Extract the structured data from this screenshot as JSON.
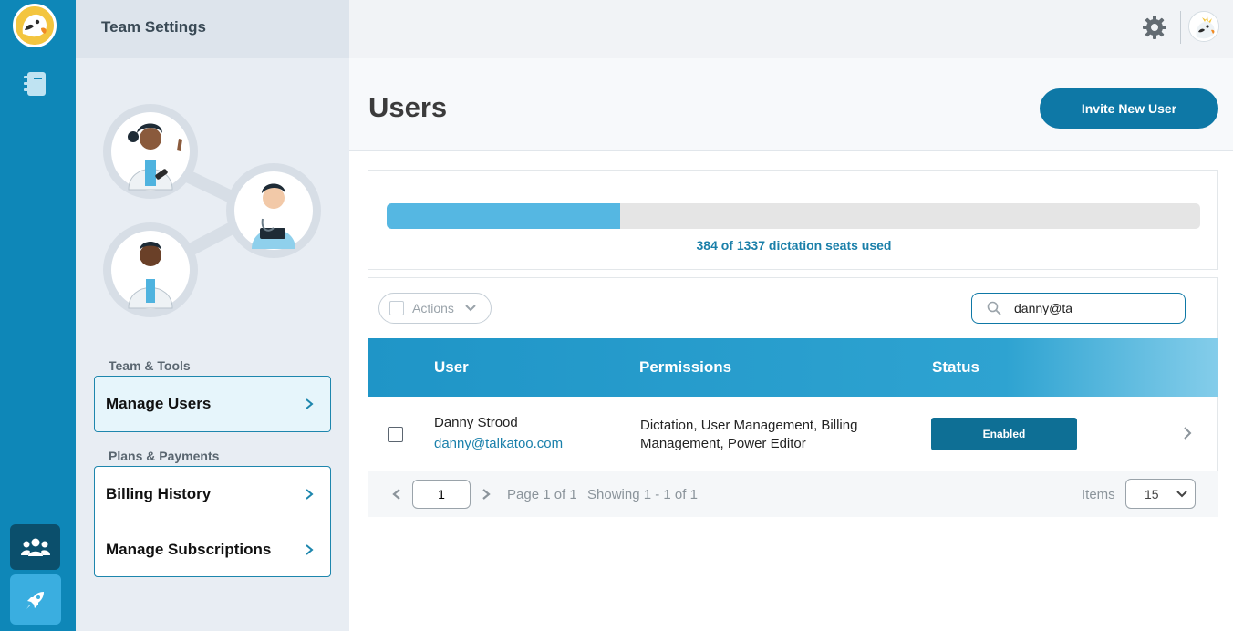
{
  "sidebar": {
    "title": "Team Settings",
    "section_team": "Team & Tools",
    "manage_users": "Manage Users",
    "section_plans": "Plans & Payments",
    "billing_history": "Billing History",
    "manage_subscriptions": "Manage Subscriptions"
  },
  "header": {
    "page_title": "Users",
    "invite_button": "Invite New User"
  },
  "seats": {
    "used": 384,
    "total": 1337,
    "fraction_used": 0.2872,
    "label": "384 of 1337 dictation seats used"
  },
  "toolbar": {
    "actions_label": "Actions",
    "search_value": "danny@ta"
  },
  "table": {
    "columns": [
      "User",
      "Permissions",
      "Status"
    ],
    "rows": [
      {
        "name": "Danny Strood",
        "email": "danny@talkatoo.com",
        "permissions": "Dictation, User Management, Billing Management, Power Editor",
        "status": "Enabled"
      }
    ]
  },
  "pagination": {
    "page_value": "1",
    "page_info": "Page 1 of 1",
    "showing": "Showing 1 - 1 of 1",
    "items_label": "Items",
    "items_value": "15"
  },
  "colors": {
    "rail": "#0e87b8",
    "accent": "#0e78a6",
    "progress_fill": "#55b7e2",
    "status_enabled": "#0e6f95"
  },
  "icons": [
    "parrot-logo-icon",
    "notebook-icon",
    "team-icon",
    "rocket-icon",
    "gear-icon",
    "search-icon",
    "chevron-right-icon",
    "chevron-left-icon",
    "chevron-down-icon"
  ]
}
